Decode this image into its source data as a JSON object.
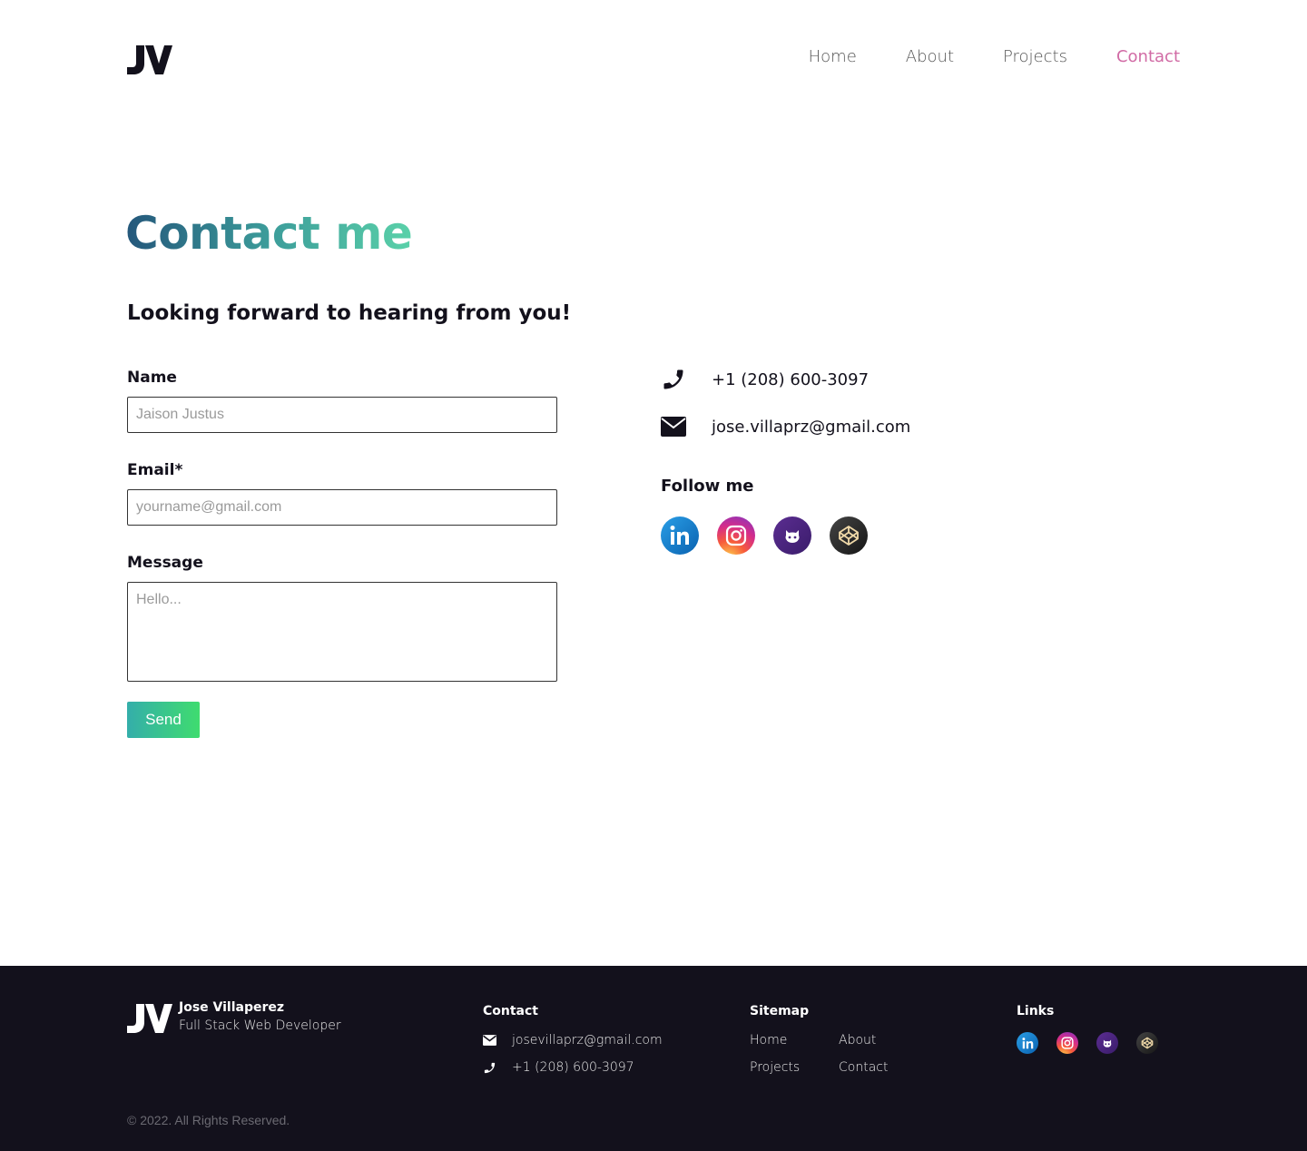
{
  "header": {
    "logo_text": "JV",
    "nav": [
      {
        "label": "Home",
        "active": false
      },
      {
        "label": "About",
        "active": false
      },
      {
        "label": "Projects",
        "active": false
      },
      {
        "label": "Contact",
        "active": true
      }
    ]
  },
  "main": {
    "title": "Contact me",
    "subtitle": "Looking forward to hearing from you!",
    "form": {
      "name_label": "Name",
      "name_placeholder": "Jaison Justus",
      "email_label": "Email*",
      "email_placeholder": "yourname@gmail.com",
      "message_label": "Message",
      "message_placeholder": "Hello...",
      "send_label": "Send"
    },
    "info": {
      "phone": "+1 (208) 600-3097",
      "email": "jose.villaprz@gmail.com",
      "follow_label": "Follow me",
      "social": [
        "linkedin-icon",
        "instagram-icon",
        "github-icon",
        "codepen-icon"
      ]
    }
  },
  "footer": {
    "name": "Jose Villaperez",
    "role": "Full Stack Web Developer",
    "contact_title": "Contact",
    "email": "josevillaprz@gmail.com",
    "phone": "+1 (208) 600-3097",
    "sitemap_title": "Sitemap",
    "sitemap": [
      "Home",
      "About",
      "Projects",
      "Contact"
    ],
    "links_title": "Links",
    "copyright": "© 2022. All Rights Reserved."
  },
  "colors": {
    "accent": "#d16ba5",
    "dark": "#13111c",
    "gradient_start": "#24577b",
    "gradient_end": "#5ad1a9",
    "button_start": "#34aeaa",
    "button_end": "#3fdc6f"
  }
}
